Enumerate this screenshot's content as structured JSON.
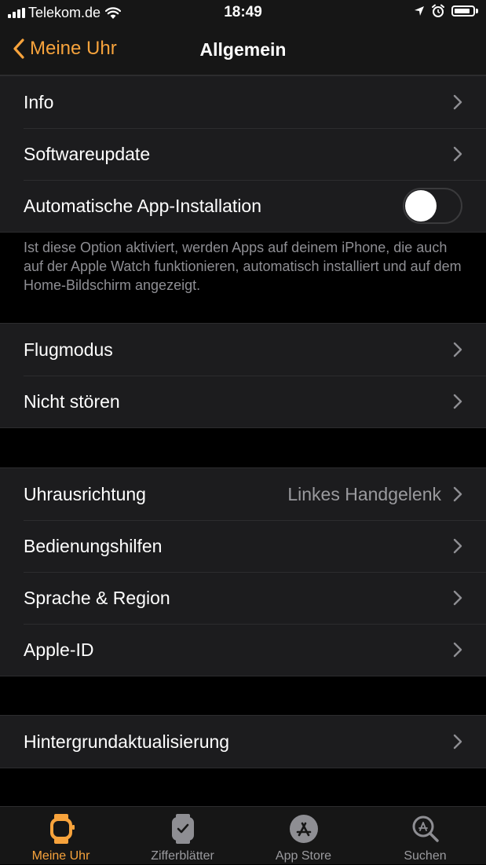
{
  "status_bar": {
    "carrier": "Telekom.de",
    "time": "18:49",
    "battery_level": 0.85
  },
  "nav": {
    "back_label": "Meine Uhr",
    "title": "Allgemein"
  },
  "group1": {
    "rows": [
      {
        "label": "Info"
      },
      {
        "label": "Softwareupdate"
      },
      {
        "label": "Automatische App-Installation",
        "toggle_on": false
      }
    ],
    "footer": "Ist diese Option aktiviert, werden Apps auf deinem iPhone, die auch auf der Apple Watch funktionieren, automatisch installiert und auf dem Home-Bildschirm angezeigt."
  },
  "group2": {
    "rows": [
      {
        "label": "Flugmodus"
      },
      {
        "label": "Nicht stören"
      }
    ]
  },
  "group3": {
    "rows": [
      {
        "label": "Uhrausrichtung",
        "value": "Linkes Handgelenk"
      },
      {
        "label": "Bedienungshilfen"
      },
      {
        "label": "Sprache & Region"
      },
      {
        "label": "Apple-ID"
      }
    ]
  },
  "group4": {
    "rows": [
      {
        "label": "Hintergrundaktualisierung"
      }
    ]
  },
  "tab_bar": {
    "active_tab": "Meine Uhr",
    "tabs": [
      {
        "label": "Meine Uhr",
        "icon": "watch-icon"
      },
      {
        "label": "Zifferblätter",
        "icon": "watch-face-icon"
      },
      {
        "label": "App Store",
        "icon": "app-store-icon"
      },
      {
        "label": "Suchen",
        "icon": "search-icon"
      }
    ]
  },
  "colors": {
    "accent": "#f7a33c",
    "background": "#000000",
    "cell": "#1c1c1e",
    "secondary_text": "#9a9a9e"
  }
}
